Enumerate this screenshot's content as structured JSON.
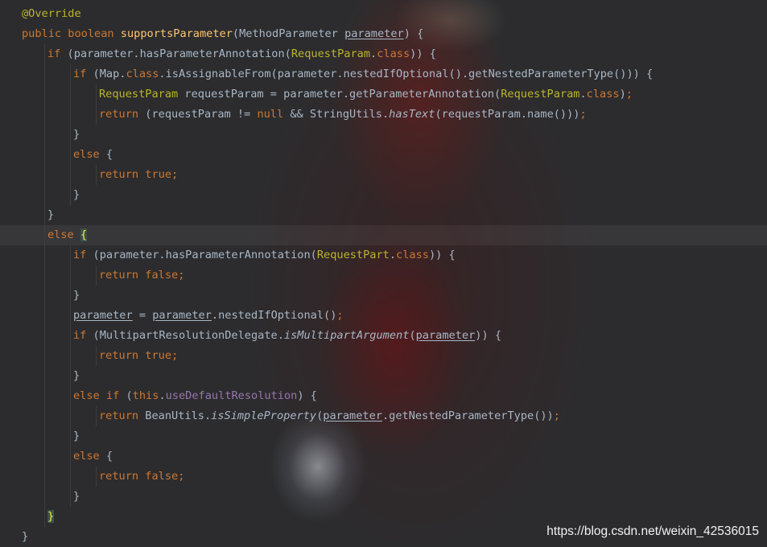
{
  "editor": {
    "lines": [
      {
        "indent": 0,
        "tokens": [
          {
            "t": "@Override",
            "c": "ann"
          }
        ]
      },
      {
        "indent": 0,
        "tokens": [
          {
            "t": "public",
            "c": "kw"
          },
          {
            "t": " "
          },
          {
            "t": "boolean",
            "c": "kw"
          },
          {
            "t": " "
          },
          {
            "t": "supportsParameter",
            "c": "fn"
          },
          {
            "t": "(MethodParameter "
          },
          {
            "t": "parameter",
            "c": "id ul"
          },
          {
            "t": ") {"
          }
        ]
      },
      {
        "indent": 1,
        "tokens": [
          {
            "t": "if",
            "c": "kw"
          },
          {
            "t": " (parameter.hasParameterAnnotation("
          },
          {
            "t": "RequestParam",
            "c": "ann"
          },
          {
            "t": "."
          },
          {
            "t": "class",
            "c": "kw"
          },
          {
            "t": ")) {"
          }
        ]
      },
      {
        "indent": 2,
        "tokens": [
          {
            "t": "if",
            "c": "kw"
          },
          {
            "t": " (Map."
          },
          {
            "t": "class",
            "c": "kw"
          },
          {
            "t": ".isAssignableFrom(parameter.nestedIfOptional().getNestedParameterType())) {"
          }
        ]
      },
      {
        "indent": 3,
        "tokens": [
          {
            "t": "RequestParam",
            "c": "ann"
          },
          {
            "t": " requestParam = parameter.getParameterAnnotation("
          },
          {
            "t": "RequestParam",
            "c": "ann"
          },
          {
            "t": "."
          },
          {
            "t": "class",
            "c": "kw"
          },
          {
            "t": ")"
          },
          {
            "t": ";",
            "c": "kw"
          }
        ]
      },
      {
        "indent": 3,
        "tokens": [
          {
            "t": "return",
            "c": "kw"
          },
          {
            "t": " (requestParam != "
          },
          {
            "t": "null",
            "c": "kw"
          },
          {
            "t": " && StringUtils."
          },
          {
            "t": "hasText",
            "c": "st"
          },
          {
            "t": "(requestParam.name()))"
          },
          {
            "t": ";",
            "c": "kw"
          }
        ]
      },
      {
        "indent": 2,
        "tokens": [
          {
            "t": "}"
          }
        ]
      },
      {
        "indent": 2,
        "tokens": [
          {
            "t": "else",
            "c": "kw"
          },
          {
            "t": " {"
          }
        ]
      },
      {
        "indent": 3,
        "tokens": [
          {
            "t": "return",
            "c": "kw"
          },
          {
            "t": " "
          },
          {
            "t": "true",
            "c": "kw"
          },
          {
            "t": ";",
            "c": "kw"
          }
        ]
      },
      {
        "indent": 2,
        "tokens": [
          {
            "t": "}"
          }
        ]
      },
      {
        "indent": 1,
        "tokens": [
          {
            "t": "}"
          }
        ]
      },
      {
        "indent": 1,
        "current": true,
        "tokens": [
          {
            "t": "else",
            "c": "kw"
          },
          {
            "t": " "
          },
          {
            "t": "{",
            "c": "brace-hl"
          }
        ]
      },
      {
        "indent": 2,
        "tokens": [
          {
            "t": "if",
            "c": "kw"
          },
          {
            "t": " (parameter.hasParameterAnnotation("
          },
          {
            "t": "RequestPart",
            "c": "ann"
          },
          {
            "t": "."
          },
          {
            "t": "class",
            "c": "kw"
          },
          {
            "t": ")) {"
          }
        ]
      },
      {
        "indent": 3,
        "tokens": [
          {
            "t": "return",
            "c": "kw"
          },
          {
            "t": " "
          },
          {
            "t": "false",
            "c": "kw"
          },
          {
            "t": ";",
            "c": "kw"
          }
        ]
      },
      {
        "indent": 2,
        "tokens": [
          {
            "t": "}"
          }
        ]
      },
      {
        "indent": 2,
        "tokens": [
          {
            "t": "parameter",
            "c": "id ul"
          },
          {
            "t": " = "
          },
          {
            "t": "parameter",
            "c": "id ul"
          },
          {
            "t": ".nestedIfOptional()"
          },
          {
            "t": ";",
            "c": "kw"
          }
        ]
      },
      {
        "indent": 2,
        "tokens": [
          {
            "t": "if",
            "c": "kw"
          },
          {
            "t": " (MultipartResolutionDelegate."
          },
          {
            "t": "isMultipartArgument",
            "c": "st"
          },
          {
            "t": "("
          },
          {
            "t": "parameter",
            "c": "id ul"
          },
          {
            "t": ")) {"
          }
        ]
      },
      {
        "indent": 3,
        "tokens": [
          {
            "t": "return",
            "c": "kw"
          },
          {
            "t": " "
          },
          {
            "t": "true",
            "c": "kw"
          },
          {
            "t": ";",
            "c": "kw"
          }
        ]
      },
      {
        "indent": 2,
        "tokens": [
          {
            "t": "}"
          }
        ]
      },
      {
        "indent": 2,
        "tokens": [
          {
            "t": "else",
            "c": "kw"
          },
          {
            "t": " "
          },
          {
            "t": "if",
            "c": "kw"
          },
          {
            "t": " ("
          },
          {
            "t": "this",
            "c": "kw"
          },
          {
            "t": "."
          },
          {
            "t": "useDefaultResolution",
            "c": "fld"
          },
          {
            "t": ") {"
          }
        ]
      },
      {
        "indent": 3,
        "tokens": [
          {
            "t": "return",
            "c": "kw"
          },
          {
            "t": " BeanUtils."
          },
          {
            "t": "isSimpleProperty",
            "c": "st"
          },
          {
            "t": "("
          },
          {
            "t": "parameter",
            "c": "id ul"
          },
          {
            "t": ".getNestedParameterType())"
          },
          {
            "t": ";",
            "c": "kw"
          }
        ]
      },
      {
        "indent": 2,
        "tokens": [
          {
            "t": "}"
          }
        ]
      },
      {
        "indent": 2,
        "tokens": [
          {
            "t": "else",
            "c": "kw"
          },
          {
            "t": " {"
          }
        ]
      },
      {
        "indent": 3,
        "tokens": [
          {
            "t": "return",
            "c": "kw"
          },
          {
            "t": " "
          },
          {
            "t": "false",
            "c": "kw"
          },
          {
            "t": ";",
            "c": "kw"
          }
        ]
      },
      {
        "indent": 2,
        "tokens": [
          {
            "t": "}"
          }
        ]
      },
      {
        "indent": 1,
        "tokens": [
          {
            "t": "}",
            "c": "brace-hl"
          }
        ]
      },
      {
        "indent": 0,
        "tokens": [
          {
            "t": "}"
          }
        ]
      }
    ]
  },
  "watermark": "https://blog.csdn.net/weixin_42536015"
}
